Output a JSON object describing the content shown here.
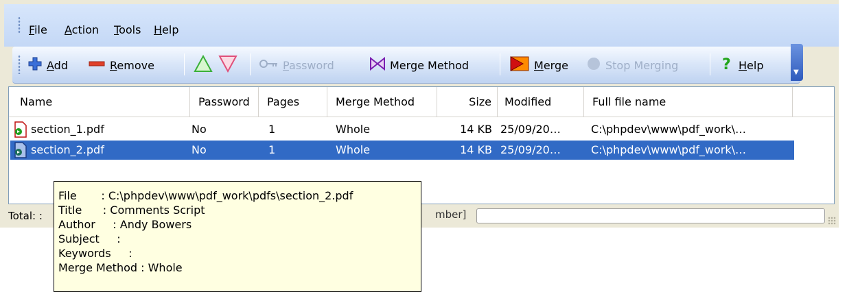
{
  "menu": {
    "file": {
      "acc": "F",
      "rest": "ile"
    },
    "action": {
      "acc": "A",
      "rest": "ction"
    },
    "tools": {
      "acc": "T",
      "rest": "ools"
    },
    "help": {
      "acc": "H",
      "rest": "elp"
    }
  },
  "toolbar": {
    "add": {
      "acc": "A",
      "rest": "dd"
    },
    "remove": {
      "acc": "R",
      "rest": "emove"
    },
    "password": {
      "acc": "P",
      "rest": "assword"
    },
    "merge_method": "Merge Method",
    "merge": {
      "acc": "M",
      "rest": "erge"
    },
    "stop_merging": "Stop Merging",
    "help": {
      "acc": "H",
      "rest": "elp"
    }
  },
  "table": {
    "columns": [
      "Name",
      "Password",
      "Pages",
      "Merge Method",
      "Size",
      "Modified",
      "Full file name"
    ],
    "rows": [
      {
        "name": "section_1.pdf",
        "password": "No",
        "pages": "1",
        "merge_method": "Whole",
        "size": "14 KB",
        "modified": "25/09/20…",
        "full": "C:\\phpdev\\www\\pdf_work\\…"
      },
      {
        "name": "section_2.pdf",
        "password": "No",
        "pages": "1",
        "merge_method": "Whole",
        "size": "14 KB",
        "modified": "25/09/20…",
        "full": "C:\\phpdev\\www\\pdf_work\\…"
      }
    ]
  },
  "status": {
    "total": "Total: :",
    "field_text": "mber]"
  },
  "tooltip": {
    "lines": [
      "File       : C:\\phpdev\\www\\pdf_work\\pdfs\\section_2.pdf",
      "Title      : Comments Script",
      "Author     : Andy Bowers",
      "Subject     :",
      "Keywords     :",
      "Merge Method : Whole"
    ]
  },
  "colors": {
    "selection": "#316ac5",
    "tooltip_bg": "#ffffe1",
    "toolbar_accent": "#2f5bbd"
  }
}
